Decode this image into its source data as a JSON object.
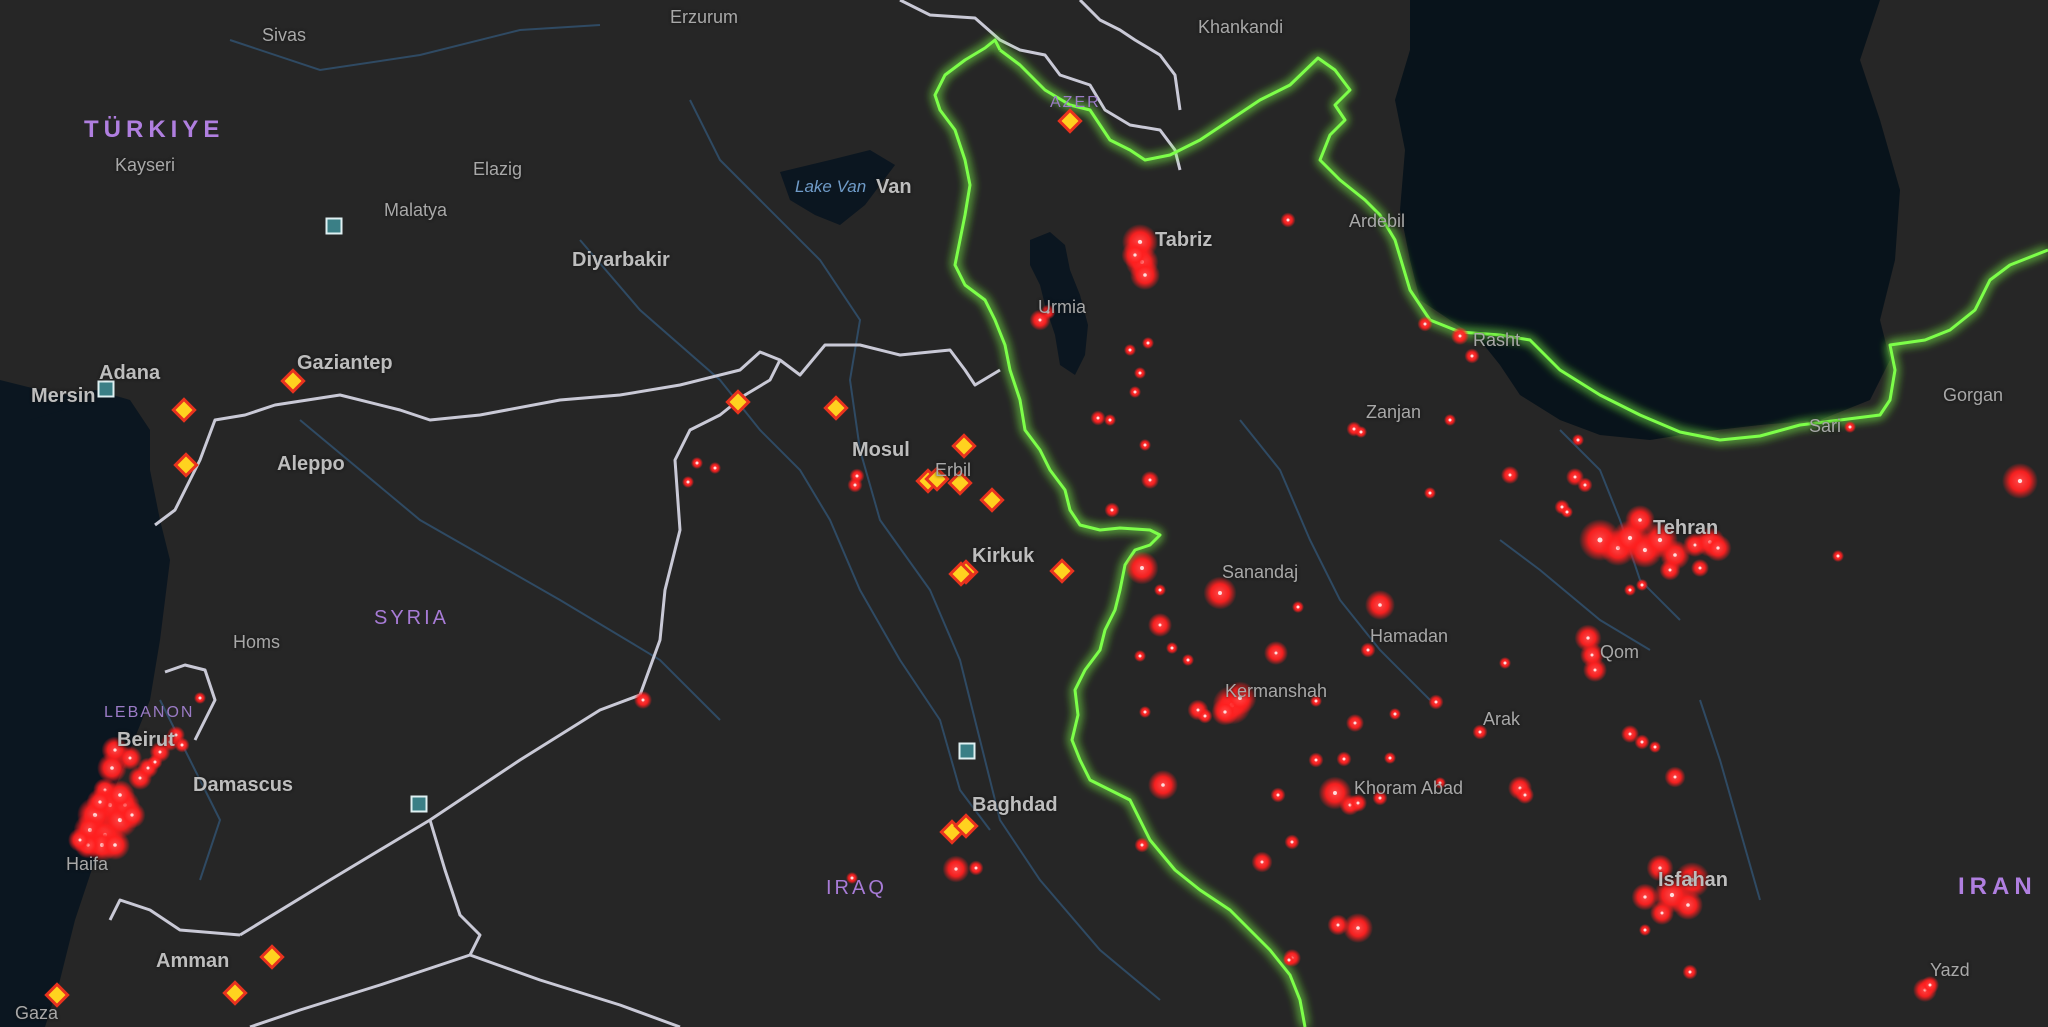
{
  "map": {
    "countries": [
      {
        "name": "TÜRKIYE",
        "key": "turkiye"
      },
      {
        "name": "SYRIA",
        "key": "syria"
      },
      {
        "name": "IRAQ",
        "key": "iraq"
      },
      {
        "name": "IRAN",
        "key": "iran"
      },
      {
        "name": "LEBANON",
        "key": "lebanon"
      },
      {
        "name": "AZER",
        "key": "azer"
      }
    ],
    "cities": {
      "sivas": "Sivas",
      "erzurum": "Erzurum",
      "khankandi": "Khankandi",
      "kayseri": "Kayseri",
      "elazig": "Elazig",
      "malatya": "Malatya",
      "van": "Van",
      "diyarbakir": "Diyarbakir",
      "adana": "Adana",
      "mersin": "Mersin",
      "gaziantep": "Gaziantep",
      "aleppo": "Aleppo",
      "homs": "Homs",
      "beirut": "Beirut",
      "damascus": "Damascus",
      "haifa": "Haifa",
      "amman": "Amman",
      "gaza": "Gaza",
      "mosul": "Mosul",
      "erbil": "Erbil",
      "kirkuk": "Kirkuk",
      "baghdad": "Baghdad",
      "tabriz": "Tabriz",
      "urmia": "Urmia",
      "ardebil": "Ardebil",
      "rasht": "Rasht",
      "zanjan": "Zanjan",
      "sari": "Sari",
      "gorgan": "Gorgan",
      "tehran": "Tehran",
      "sanandaj": "Sanandaj",
      "hamadan": "Hamadan",
      "qom": "Qom",
      "kermanshah": "Kermanshah",
      "arak": "Arak",
      "khoram_abad": "Khoram Abad",
      "isfahan": "Isfahan",
      "yazd": "Yazd"
    },
    "water": {
      "lake_van": "Lake Van"
    },
    "colors": {
      "background": "#262626",
      "sea": "#0b1620",
      "border": "#c9c9d6",
      "highlight_border": "#7dff4a",
      "river": "#2f4a63",
      "event_dot": "#ff1f1f",
      "diamond_fill": "#ffd21f",
      "diamond_stroke": "#e8321e",
      "square_fill": "#3a7f86",
      "square_stroke": "#dff0f2"
    },
    "marker_types": [
      "event-dot",
      "diamond-marker",
      "square-marker"
    ]
  }
}
